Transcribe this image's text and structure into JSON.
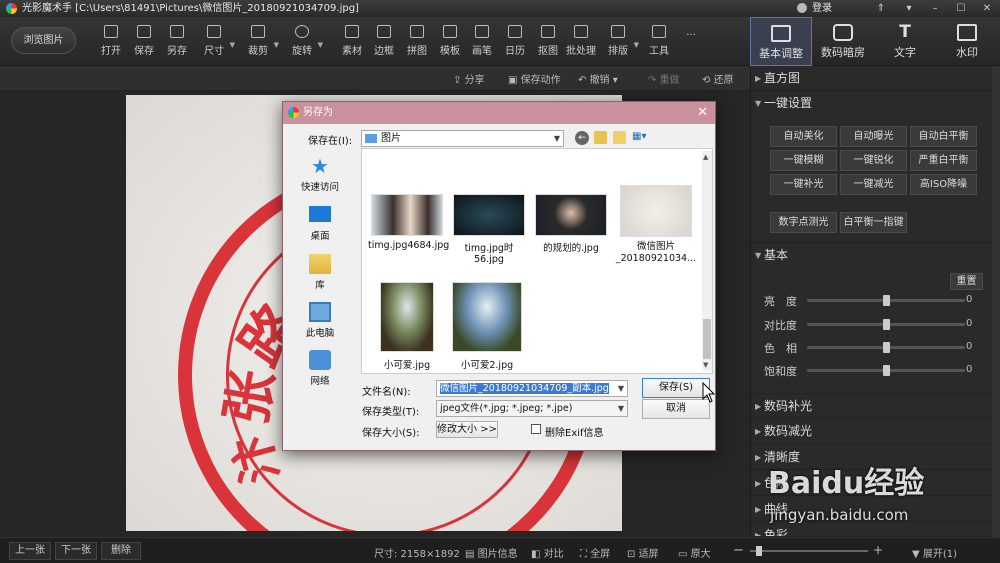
{
  "window": {
    "title": "光影魔术手 [C:\\Users\\81491\\Pictures\\微信图片_20180921034709.jpg]",
    "login_label": "登录"
  },
  "toolbar": {
    "browse_label": "浏览图片",
    "tools": [
      {
        "label": "打开",
        "icon": "open-icon"
      },
      {
        "label": "保存",
        "icon": "save-icon"
      },
      {
        "label": "另存",
        "icon": "save-as-icon"
      },
      {
        "label": "尺寸",
        "icon": "resize-icon"
      },
      {
        "label": "裁剪",
        "icon": "crop-icon"
      },
      {
        "label": "旋转",
        "icon": "rotate-icon"
      },
      {
        "label": "素材",
        "icon": "material-icon"
      },
      {
        "label": "边框",
        "icon": "border-icon"
      },
      {
        "label": "拼图",
        "icon": "collage-icon"
      },
      {
        "label": "模板",
        "icon": "template-icon"
      },
      {
        "label": "画笔",
        "icon": "brush-icon"
      },
      {
        "label": "日历",
        "icon": "calendar-icon"
      },
      {
        "label": "抠图",
        "icon": "cutout-icon"
      },
      {
        "label": "批处理",
        "icon": "batch-icon"
      },
      {
        "label": "排版",
        "icon": "layout-icon"
      },
      {
        "label": "工具",
        "icon": "tools-icon"
      }
    ],
    "more_label": "...",
    "right_tabs": [
      {
        "label": "基本调整",
        "icon": "adjust-icon",
        "active": true
      },
      {
        "label": "数码暗房",
        "icon": "darkroom-icon",
        "active": false
      },
      {
        "label": "文字",
        "icon": "text-icon",
        "active": false
      },
      {
        "label": "水印",
        "icon": "watermark-icon",
        "active": false
      }
    ]
  },
  "actionbar": {
    "share": "分享",
    "save_action": "保存动作",
    "undo": "撤销",
    "redo": "重做",
    "restore": "还原"
  },
  "right_panel": {
    "histogram": "直方图",
    "one_click": "一键设置",
    "one_click_buttons": [
      "自动美化",
      "自动曝光",
      "自动白平衡",
      "一键模糊",
      "一键锐化",
      "严重白平衡",
      "一键补光",
      "一键减光",
      "高ISO降噪"
    ],
    "extra_buttons": [
      "数字点测光",
      "白平衡一指键"
    ],
    "basic": "基本",
    "reset": "重置",
    "sliders": [
      {
        "label": "亮　度",
        "value": "0"
      },
      {
        "label": "对比度",
        "value": "0"
      },
      {
        "label": "色　相",
        "value": "0"
      },
      {
        "label": "饱和度",
        "value": "0"
      }
    ],
    "sections_below": [
      "数码补光",
      "数码减光",
      "清晰度",
      "色阶",
      "曲线",
      "色彩"
    ]
  },
  "dialog": {
    "title": "另存为",
    "save_in_label": "保存在(I):",
    "save_in_value": "图片",
    "places": [
      "快速访问",
      "桌面",
      "库",
      "此电脑",
      "网络"
    ],
    "files": [
      {
        "name": "timg.jpg4684.jpg"
      },
      {
        "name": "timg.jpg时56.jpg"
      },
      {
        "name": "的规划的.jpg"
      },
      {
        "name": "微信图片_20180921034..."
      },
      {
        "name": "小可爱.jpg"
      },
      {
        "name": "小可爱2.jpg"
      }
    ],
    "filename_label": "文件名(N):",
    "filename_value": "微信图片_20180921034709_副本.jpg",
    "filetype_label": "保存类型(T):",
    "filetype_value": "jpeg文件(*.jpg; *.jpeg; *.jpe)",
    "savesize_label": "保存大小(S):",
    "resize_button": "修改大小 >>",
    "exif_label": "删除Exif信息",
    "save_button": "保存(S)",
    "cancel_button": "取消"
  },
  "statusbar": {
    "prev": "上一张",
    "next": "下一张",
    "delete": "删除",
    "size": "尺寸: 2158×1892",
    "info": "图片信息",
    "compare": "对比",
    "fullscreen": "全屏",
    "fit": "适屏",
    "original": "原大",
    "expand": "展开(1)"
  },
  "watermark": {
    "text": "Baidu经验",
    "url": "jingyan.baidu.com"
  }
}
